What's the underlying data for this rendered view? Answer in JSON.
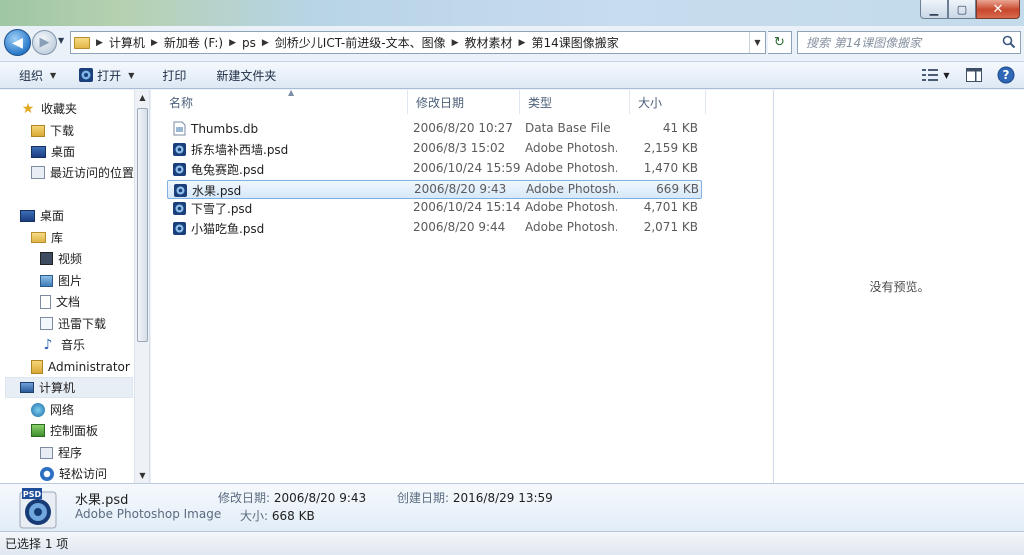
{
  "window": {
    "caption_buttons": {
      "minimize": "▁",
      "maximize": "▢",
      "close": "✕"
    }
  },
  "address": {
    "breadcrumbs": [
      "计算机",
      "新加卷 (F:)",
      "ps",
      "剑桥少儿ICT-前进级-文本、图像",
      "教材素材",
      "第14课图像搬家"
    ]
  },
  "search": {
    "placeholder": "搜索 第14课图像搬家"
  },
  "toolbar": {
    "organize": "组织",
    "open": "打开",
    "print": "打印",
    "new_folder": "新建文件夹"
  },
  "nav": {
    "favorites": {
      "label": "收藏夹",
      "items": [
        "下载",
        "桌面",
        "最近访问的位置"
      ]
    },
    "desktop": "桌面",
    "library": {
      "label": "库",
      "items": [
        "视频",
        "图片",
        "文档",
        "迅雷下载",
        "音乐"
      ]
    },
    "administrator": "Administrator",
    "computer": "计算机",
    "network": "网络",
    "control_panel": {
      "label": "控制面板",
      "items": [
        "程序",
        "轻松访问"
      ]
    }
  },
  "columns": {
    "name": "名称",
    "date": "修改日期",
    "type": "类型",
    "size": "大小"
  },
  "files": [
    {
      "name": "Thumbs.db",
      "date": "2006/8/20 10:27",
      "type": "Data Base File",
      "size": "41 KB",
      "kind": "db"
    },
    {
      "name": "拆东墙补西墙.psd",
      "date": "2006/8/3 15:02",
      "type": "Adobe Photosh...",
      "size": "2,159 KB",
      "kind": "psd"
    },
    {
      "name": "龟兔赛跑.psd",
      "date": "2006/10/24 15:59",
      "type": "Adobe Photosh...",
      "size": "1,470 KB",
      "kind": "psd"
    },
    {
      "name": "水果.psd",
      "date": "2006/8/20 9:43",
      "type": "Adobe Photosh...",
      "size": "669 KB",
      "kind": "psd",
      "selected": true
    },
    {
      "name": "下雪了.psd",
      "date": "2006/10/24 15:14",
      "type": "Adobe Photosh...",
      "size": "4,701 KB",
      "kind": "psd"
    },
    {
      "name": "小猫吃鱼.psd",
      "date": "2006/8/20 9:44",
      "type": "Adobe Photosh...",
      "size": "2,071 KB",
      "kind": "psd"
    }
  ],
  "preview": {
    "text": "没有预览。"
  },
  "details": {
    "icon_label": "PSD",
    "file_name": "水果.psd",
    "file_type": "Adobe Photoshop Image",
    "modified_label": "修改日期:",
    "modified_value": "2006/8/20 9:43",
    "size_label": "大小:",
    "size_value": "668 KB",
    "created_label": "创建日期:",
    "created_value": "2016/8/29 13:59"
  },
  "status": {
    "text": "已选择 1 项"
  }
}
